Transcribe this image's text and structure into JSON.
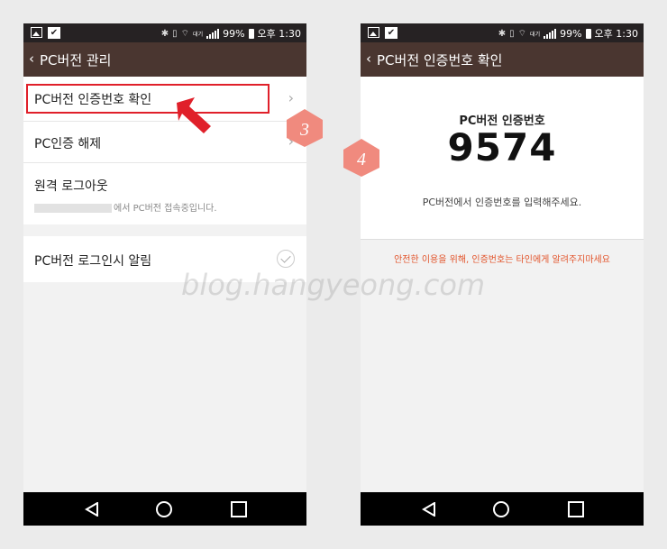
{
  "status_bar": {
    "wifi_label": "대기",
    "battery": "99%",
    "time": "오후 1:30"
  },
  "left_screen": {
    "title": "PC버전 관리",
    "items": [
      {
        "label": "PC버전 인증번호 확인"
      },
      {
        "label": "PC인증 해제"
      },
      {
        "label": "원격 로그아웃",
        "subtitle": "에서 PC버전 접속중입니다."
      },
      {
        "label": "PC버전 로그인시 알림"
      }
    ]
  },
  "right_screen": {
    "title": "PC버전 인증번호 확인",
    "code_title": "PC버전 인증번호",
    "code": "9574",
    "description": "PC버전에서 인증번호를 입력해주세요.",
    "warning": "안전한 이용을 위해, 인증번호는 타인에게 알려주지마세요"
  },
  "badges": [
    "3",
    "4"
  ],
  "watermark": "blog.hangyeong.com",
  "colors": {
    "app_bar": "#4a3630",
    "status_bar": "#262223",
    "highlight": "#e0202a",
    "badge": "#f08a7e",
    "warning": "#e2542b"
  },
  "icons": [
    "image-icon",
    "app-icon",
    "bluetooth-icon",
    "vibrate-icon",
    "wifi-icon",
    "signal-icon",
    "battery-icon",
    "back-icon",
    "chevron-right-icon",
    "check-icon",
    "nav-back-icon",
    "nav-home-icon",
    "nav-recent-icon",
    "pointer-arrow-icon"
  ]
}
